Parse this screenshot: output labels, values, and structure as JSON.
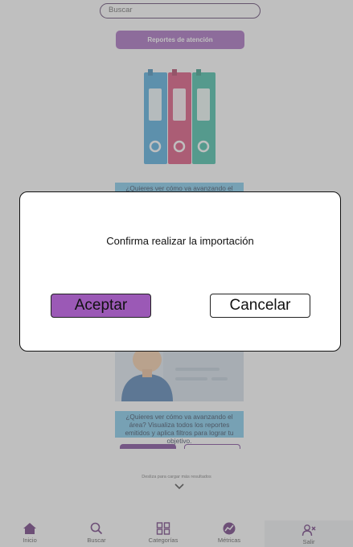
{
  "search": {
    "placeholder": "Buscar"
  },
  "reports_button": {
    "label": "Reportes de atención"
  },
  "card_top": {
    "caption": "¿Quieres ver cómo va avanzando el área?"
  },
  "card_bottom": {
    "caption": "¿Quieres ver cómo va avanzando el área? Visualiza todos los reportes emitidos y aplica filtros para lograr tu objetivo."
  },
  "scroll_hint": {
    "label": "Desliza para cargar más resultados"
  },
  "nav": {
    "items": [
      {
        "label": "Inicio",
        "icon": "home-icon"
      },
      {
        "label": "Buscar",
        "icon": "search-icon"
      },
      {
        "label": "Categorías",
        "icon": "grid-icon"
      },
      {
        "label": "Métricas",
        "icon": "metrics-icon"
      },
      {
        "label": "Salir",
        "icon": "user-remove-icon"
      }
    ]
  },
  "dialog": {
    "message": "Confirma realizar la importación",
    "accept_label": "Aceptar",
    "cancel_label": "Cancelar"
  },
  "colors": {
    "accent": "#9b59b6",
    "accent_dark": "#6a2e8a",
    "card_blue": "#6ec3e8",
    "binder_blue": "#3aa0d8",
    "binder_red": "#d63a6a",
    "binder_green": "#2ab59a"
  }
}
